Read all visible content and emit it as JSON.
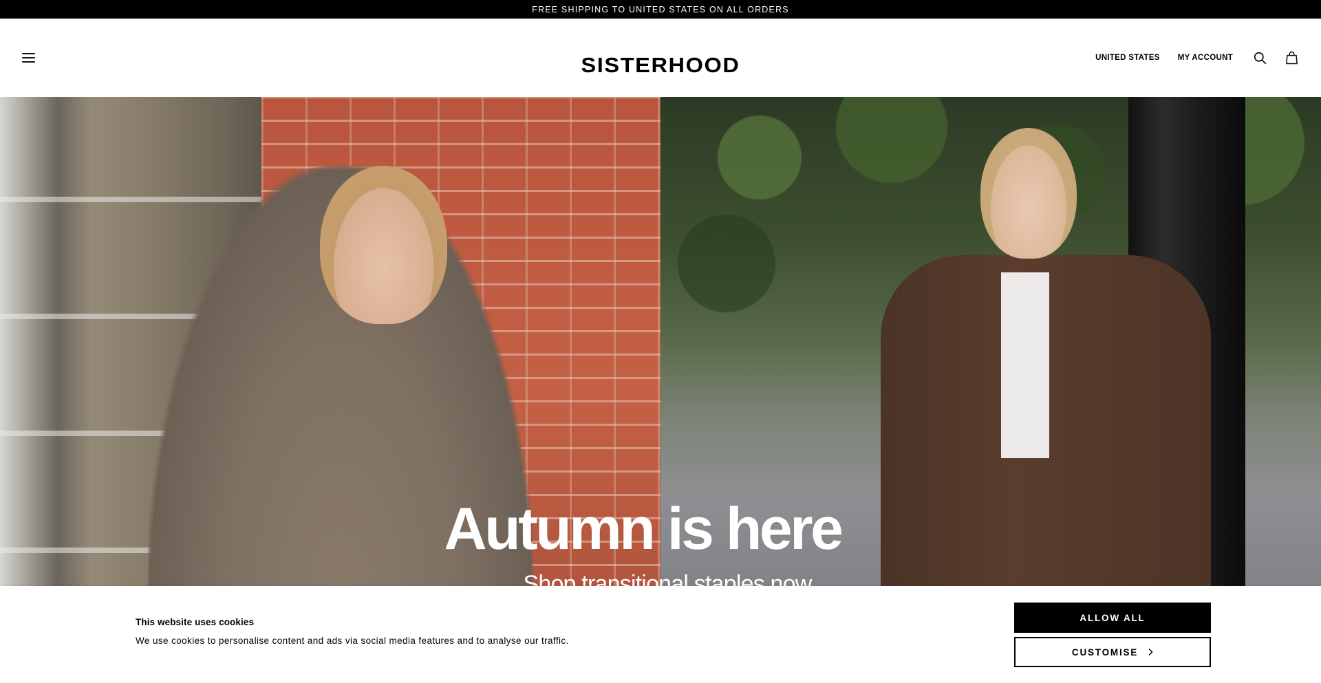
{
  "announcement": {
    "text": "FREE SHIPPING TO UNITED STATES ON ALL ORDERS"
  },
  "header": {
    "logo": "SISTERHOOD",
    "menu_icon": "hamburger-menu-icon",
    "region_label": "UNITED STATES",
    "account_label": "MY ACCOUNT",
    "search_icon": "search-icon",
    "cart_icon": "shopping-bag-icon"
  },
  "hero": {
    "title": "Autumn is here",
    "subtitle": "Shop transitional staples now"
  },
  "cookie_banner": {
    "title": "This website uses cookies",
    "text": "We use cookies to personalise content and ads via social media features and to analyse our traffic.",
    "allow_label": "ALLOW ALL",
    "customise_label": "CUSTOMISE",
    "customise_icon": "chevron-right-icon"
  }
}
